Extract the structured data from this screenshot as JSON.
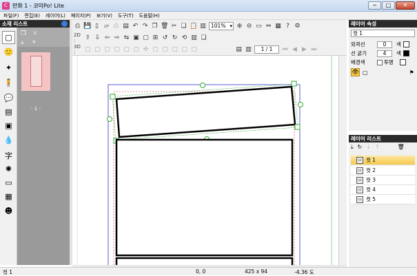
{
  "window": {
    "title": "만화 1 - 코미Po! Lite",
    "minimize": "─",
    "maximize": "□",
    "close": "✕"
  },
  "menu": [
    "파일(F)",
    "편집(E)",
    "레이어(L)",
    "페이지(P)",
    "보기(V)",
    "도구(T)",
    "도움말(H)"
  ],
  "material_list": {
    "title": "소재 리스트",
    "thumbnail_label": "- 1 -"
  },
  "toolbar": {
    "row2_label": "2D :",
    "row3_label": "3D :",
    "zoom": "101%",
    "page": "1 / 1"
  },
  "layer_props": {
    "title": "레이어 속성",
    "cut_name": "컷 1",
    "outline_label": "외곽선",
    "outline_value": "0",
    "outline_color_label": "색",
    "line_weight_label": "선 굵기",
    "line_weight_value": "4",
    "line_color_label": "색",
    "bg_label": "배경색",
    "transparent_label": "투명",
    "colors": {
      "outline": "#ffffff",
      "line": "#000000",
      "bg": "#ffffff"
    }
  },
  "layer_list": {
    "title": "레이어 리스트",
    "items": [
      "컷 1",
      "컷 2",
      "컷 3",
      "컷 4",
      "컷 5"
    ],
    "selected": 0
  },
  "status": {
    "left": "컷 1",
    "coords": "0, 0",
    "size": "425 x 94",
    "angle": "-4.36 도"
  }
}
